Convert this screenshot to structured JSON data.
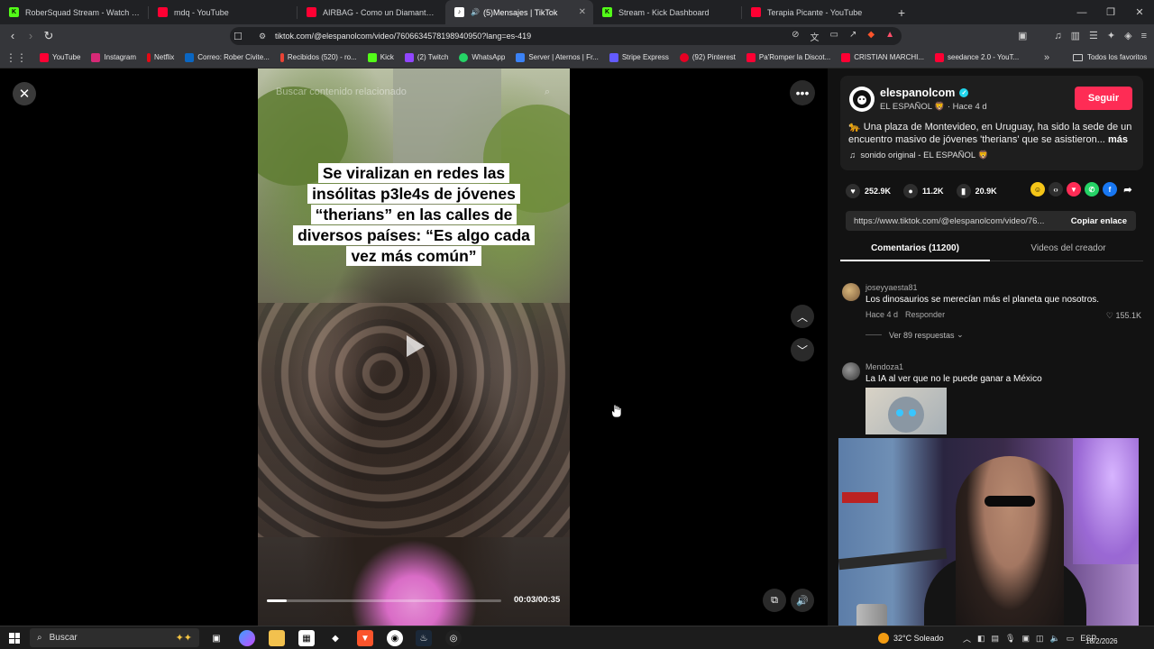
{
  "browser": {
    "tabs": [
      {
        "title": "RoberSquad Stream - Watch Live",
        "icon_color": "#53fc18",
        "active": false
      },
      {
        "title": "mdq - YouTube",
        "icon_color": "#ff0033",
        "active": false
      },
      {
        "title": "AIRBAG - Como un Diamante - video",
        "icon_color": "#ff0033",
        "active": false
      },
      {
        "title": "(5)Mensajes | TikTok",
        "icon_color": "#ffffff",
        "active": true
      },
      {
        "title": "Stream - Kick Dashboard",
        "icon_color": "#53fc18",
        "active": false
      },
      {
        "title": "Terapia Picante - YouTube",
        "icon_color": "#ff0033",
        "active": false
      }
    ],
    "url": "tiktok.com/@elespanolcom/video/7606634578198940950?lang=es-419",
    "bookmarks": [
      {
        "label": "YouTube",
        "color": "#ff0033"
      },
      {
        "label": "Instagram",
        "color": "#d62976"
      },
      {
        "label": "Netflix",
        "color": "#e50914"
      },
      {
        "label": "Correo: Rober Civite...",
        "color": "#0a66c2"
      },
      {
        "label": "Recibidos (520) - ro...",
        "color": "#ea4335"
      },
      {
        "label": "Kick",
        "color": "#53fc18"
      },
      {
        "label": "(2) Twitch",
        "color": "#9146ff"
      },
      {
        "label": "WhatsApp",
        "color": "#25d366"
      },
      {
        "label": "Server | Aternos | Fr...",
        "color": "#3b82f6"
      },
      {
        "label": "Stripe Express",
        "color": "#635bff"
      },
      {
        "label": "(92) Pinterest",
        "color": "#e60023"
      },
      {
        "label": "Pa'Romper la Discot...",
        "color": "#ff0033"
      },
      {
        "label": "CRISTIAN MARCHI...",
        "color": "#ff0033"
      },
      {
        "label": "seedance 2.0 - YouT...",
        "color": "#ff0033"
      }
    ],
    "all_favorites": "Todos los favoritos"
  },
  "video": {
    "search_placeholder": "Buscar contenido relacionado",
    "headline": "Se viralizan en redes las insólitas p3le4s de jóvenes “therians” en las calles de diversos países: “Es algo cada vez más común”",
    "time": "00:03/00:35",
    "progress": 0.086
  },
  "post": {
    "username": "elespanolcom",
    "subline": "EL ESPAÑOL 🦁 · Hace 4 d",
    "follow_label": "Seguir",
    "description": "🐆 Una plaza de Montevideo, en Uruguay, ha sido la sede de un encuentro masivo de jóvenes 'therians' que se asistieron...",
    "more_label": "más",
    "sound": "sonido original - EL ESPAÑOL 🦁",
    "likes": "252.9K",
    "comments": "11.2K",
    "saves": "20.9K",
    "link": "https://www.tiktok.com/@elespanolcom/video/76...",
    "copy_label": "Copiar enlace"
  },
  "tabs": {
    "comments": "Comentarios (11200)",
    "creator_videos": "Videos del creador"
  },
  "comments": [
    {
      "user": "joseyyaesta81",
      "text": "Los dinosaurios se merecían más el planeta que nosotros.",
      "time": "Hace 4 d",
      "reply": "Responder",
      "likes": "155.1K",
      "view_replies": "Ver 89 respuestas"
    },
    {
      "user": "Mendoza1",
      "text": "La IA al ver que no le puede ganar a México"
    }
  ],
  "taskbar": {
    "search_placeholder": "Buscar",
    "weather": "32°C  Soleado",
    "lang": "ESP",
    "date": "18/2/2026"
  }
}
